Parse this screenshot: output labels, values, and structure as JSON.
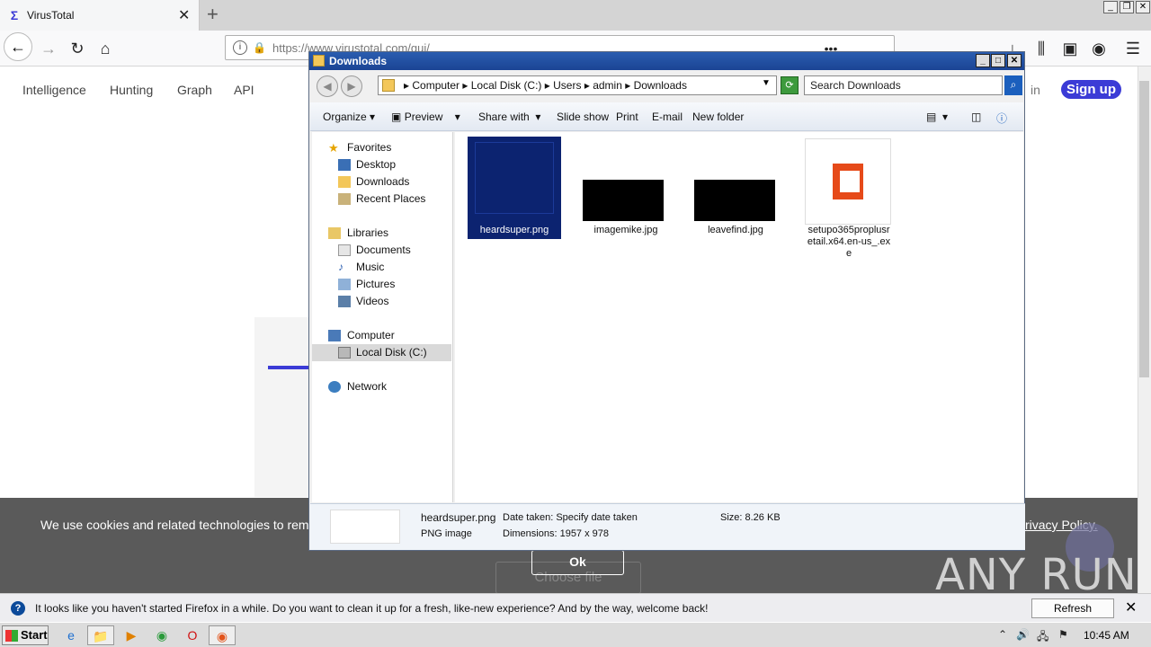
{
  "browser": {
    "tab_title": "VirusTotal",
    "url": "https://www.virustotal.com/gui/",
    "new_tab_icon": "+"
  },
  "page": {
    "nav": [
      "Intelligence",
      "Hunting",
      "Graph",
      "API"
    ],
    "signin_fragment": "in",
    "signup_label": "Sign up",
    "cookie_text": "We use cookies and related technologies to rem",
    "privacy_fragment": "rivacy Policy.",
    "ok_label": "Ok",
    "choose_file_label": "Choose file",
    "watermark": "ANY RUN",
    "brand_color": "#3b3bd6"
  },
  "notification": {
    "message": "It looks like you haven't started Firefox in a while. Do you want to clean it up for a fresh, like-new experience? And by the way, welcome back!",
    "button": "Refresh Firefox…"
  },
  "taskbar": {
    "start": "Start",
    "time": "10:45 AM"
  },
  "explorer": {
    "title": "Downloads",
    "breadcrumb": [
      "Computer",
      "Local Disk (C:)",
      "Users",
      "admin",
      "Downloads"
    ],
    "search_placeholder": "Search Downloads",
    "toolbar": [
      "Organize",
      "Preview",
      "Share with",
      "Slide show",
      "Print",
      "E-mail",
      "New folder"
    ],
    "nav": {
      "favorites": "Favorites",
      "fav_items": [
        "Desktop",
        "Downloads",
        "Recent Places"
      ],
      "libraries": "Libraries",
      "lib_items": [
        "Documents",
        "Music",
        "Pictures",
        "Videos"
      ],
      "computer": "Computer",
      "disk": "Local Disk (C:)",
      "network": "Network"
    },
    "files": [
      {
        "name": "heardsuper.png"
      },
      {
        "name": "imagemike.jpg"
      },
      {
        "name": "leavefind.jpg"
      },
      {
        "name": "setupo365proplusretail.x64.en-us_.exe"
      }
    ],
    "details": {
      "name": "heardsuper.png",
      "type": "PNG image",
      "date_taken": "Date taken: Specify date taken",
      "dimensions": "Dimensions: 1957 x 978",
      "size": "Size: 8.26 KB"
    }
  }
}
